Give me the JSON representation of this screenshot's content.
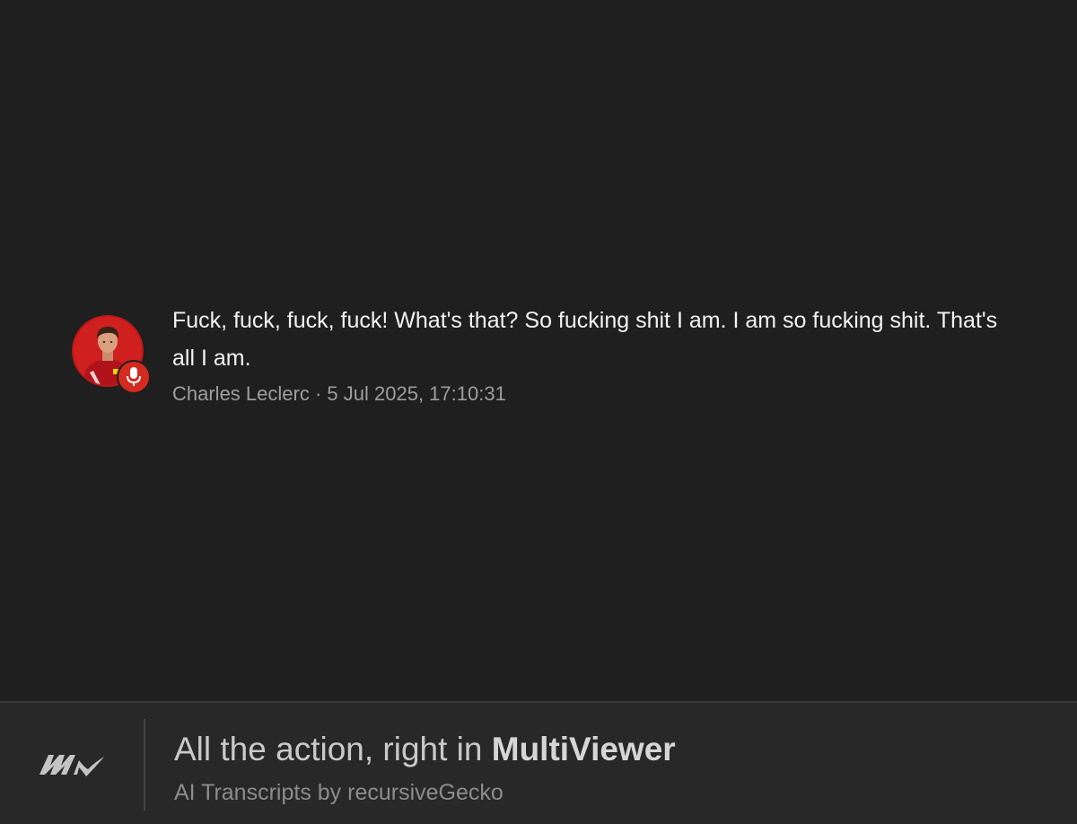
{
  "transcript": {
    "message": "Fuck, fuck, fuck, fuck! What's that? So fucking shit I am. I am so fucking shit. That's all I am.",
    "speaker": "Charles Leclerc",
    "separator": "·",
    "timestamp": "5 Jul 2025, 17:10:31",
    "avatar_icon": "driver-portrait",
    "badge_icon": "microphone-icon",
    "accent_color": "#d42a20"
  },
  "footer": {
    "logo_icon": "multiviewer-logo-icon",
    "headline_prefix": "All the action, right in ",
    "headline_brand": "MultiViewer",
    "subline": "AI Transcripts by recursiveGecko"
  }
}
